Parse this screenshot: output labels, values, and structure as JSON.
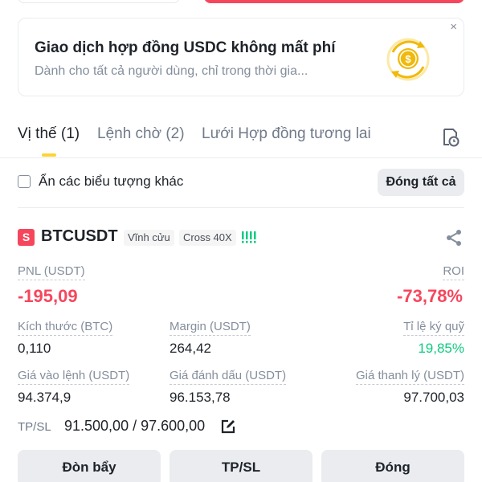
{
  "promo": {
    "title": "Giao dịch hợp đồng USDC không mất phí",
    "subtitle": "Dành cho tất cả người dùng, chỉ trong thời gia...",
    "close": "×",
    "icon": "usdc-coin-icon"
  },
  "tabs": [
    {
      "label": "Vị thế (1)",
      "active": true
    },
    {
      "label": "Lệnh chờ (2)",
      "active": false
    },
    {
      "label": "Lưới Hợp đồng tương lai",
      "active": false
    }
  ],
  "filter": {
    "hide_label": "Ẩn các biểu tượng khác",
    "close_all_label": "Đóng tất cả"
  },
  "position": {
    "badge": "S",
    "symbol": "BTCUSDT",
    "tag_perpetual": "Vĩnh cửu",
    "tag_margin": "Cross 40X",
    "signal_level": "!!!!",
    "pnl_label": "PNL (USDT)",
    "pnl_value": "-195,09",
    "roi_label": "ROI",
    "roi_value": "-73,78%",
    "size_label": "Kích thước (BTC)",
    "size_value": "0,110",
    "margin_label": "Margin (USDT)",
    "margin_value": "264,42",
    "margin_ratio_label": "Tỉ lệ ký quỹ",
    "margin_ratio_value": "19,85%",
    "entry_label": "Giá vào lệnh (USDT)",
    "entry_value": "94.374,9",
    "mark_label": "Giá đánh dấu (USDT)",
    "mark_value": "96.153,78",
    "liq_label": "Giá thanh lý (USDT)",
    "liq_value": "97.700,03",
    "tpsl_label": "TP/SL",
    "tpsl_value": "91.500,00 / 97.600,00"
  },
  "actions": {
    "leverage": "Đòn bẩy",
    "tpsl": "TP/SL",
    "close": "Đóng"
  },
  "colors": {
    "red": "#f6465d",
    "green": "#0ecb81",
    "yellow": "#fcd535"
  }
}
